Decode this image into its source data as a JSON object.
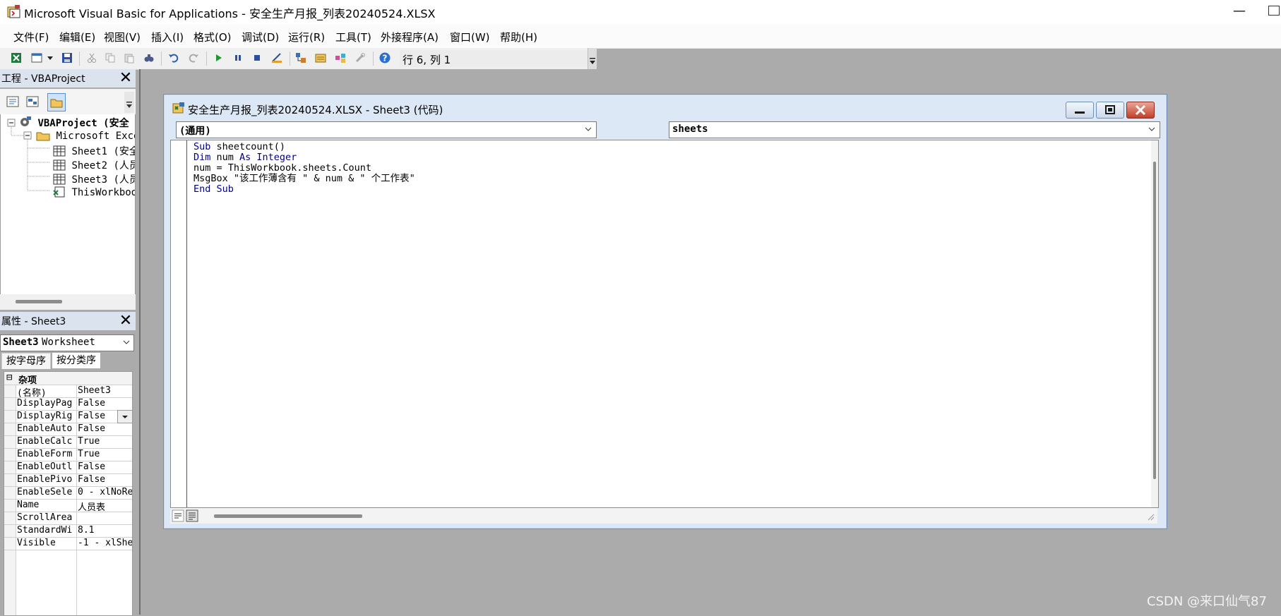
{
  "app": {
    "title": "Microsoft Visual Basic for Applications - 安全生产月报_列表20240524.XLSX",
    "minimize_glyph": "—"
  },
  "menu": {
    "items": [
      "文件(F)",
      "编辑(E)",
      "视图(V)",
      "插入(I)",
      "格式(O)",
      "调试(D)",
      "运行(R)",
      "工具(T)",
      "外接程序(A)",
      "窗口(W)",
      "帮助(H)"
    ]
  },
  "toolbar": {
    "position": "行 6, 列 1",
    "icons": [
      "excel-icon",
      "insert-module-icon",
      "dropdown-icon",
      "save-icon",
      "cut-icon",
      "copy-icon",
      "paste-icon",
      "find-icon",
      "undo-icon",
      "redo-icon",
      "run-icon",
      "pause-icon",
      "stop-icon",
      "design-mode-icon",
      "project-explorer-icon",
      "properties-icon",
      "object-browser-icon",
      "toolbox-icon",
      "help-icon"
    ]
  },
  "project_panel": {
    "title": "工程 - VBAProject",
    "close_glyph": "✕",
    "tree": [
      {
        "label": "VBAProject (安全",
        "level": 0,
        "bold": true
      },
      {
        "label": "Microsoft Exce",
        "level": 1,
        "bold": false
      },
      {
        "label": "Sheet1 (安全",
        "level": 2,
        "bold": false
      },
      {
        "label": "Sheet2 (人员",
        "level": 2,
        "bold": false
      },
      {
        "label": "Sheet3 (人员",
        "level": 2,
        "bold": false
      },
      {
        "label": "ThisWorkbook",
        "level": 2,
        "bold": false
      }
    ]
  },
  "properties_panel": {
    "title": "属性 - Sheet3",
    "close_glyph": "✕",
    "object_name": "Sheet3",
    "object_type": "Worksheet",
    "tabs": [
      "按字母序",
      "按分类序"
    ],
    "category": "杂项",
    "category_toggle": "⊟",
    "rows": [
      {
        "name": "(名称)",
        "value": "Sheet3"
      },
      {
        "name": "DisplayPag",
        "value": "False"
      },
      {
        "name": "DisplayRig",
        "value": "False"
      },
      {
        "name": "EnableAuto",
        "value": "False"
      },
      {
        "name": "EnableCalc",
        "value": "True"
      },
      {
        "name": "EnableForm",
        "value": "True"
      },
      {
        "name": "EnableOutl",
        "value": "False"
      },
      {
        "name": "EnablePivo",
        "value": "False"
      },
      {
        "name": "EnableSele",
        "value": "0 - xlNoRe"
      },
      {
        "name": "Name",
        "value": "人员表"
      },
      {
        "name": "ScrollArea",
        "value": ""
      },
      {
        "name": "StandardWi",
        "value": "8.1"
      },
      {
        "name": "Visible",
        "value": "-1 - xlShe"
      }
    ]
  },
  "code_window": {
    "title": "安全生产月报_列表20240524.XLSX - Sheet3 (代码)",
    "object_combo": "(通用)",
    "procedure_combo": "sheets",
    "code_lines": [
      [
        {
          "t": "Sub",
          "k": true
        },
        {
          "t": " sheetcount()",
          "k": false
        }
      ],
      [
        {
          "t": "Dim",
          "k": true
        },
        {
          "t": " num ",
          "k": false
        },
        {
          "t": "As Integer",
          "k": true
        }
      ],
      [
        {
          "t": "num = ThisWorkbook.sheets.Count",
          "k": false
        }
      ],
      [
        {
          "t": "MsgBox \"该工作薄含有 \" & num & \" 个工作表\"",
          "k": false
        }
      ],
      [
        {
          "t": "End Sub",
          "k": true
        }
      ]
    ]
  },
  "watermark": "CSDN @来口仙气87"
}
